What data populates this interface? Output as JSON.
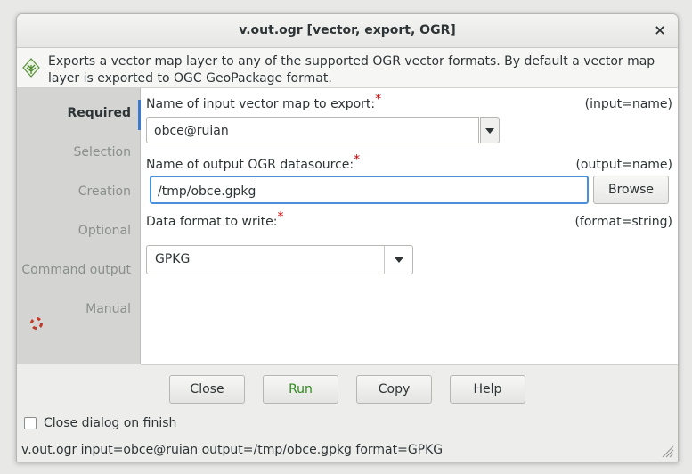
{
  "window": {
    "title": "v.out.ogr [vector, export, OGR]",
    "close_label": "×",
    "description": "Exports a vector map layer to any of the supported OGR vector formats. By default a vector map layer is exported to OGC GeoPackage format."
  },
  "sidebar": {
    "tabs": [
      "Required",
      "Selection",
      "Creation",
      "Optional",
      "Command output",
      "Manual"
    ],
    "active": "Required"
  },
  "form": {
    "input": {
      "label": "Name of input vector map to export:",
      "required_mark": "*",
      "param": "(input=name)",
      "value": "obce@ruian"
    },
    "output": {
      "label": "Name of output OGR datasource:",
      "required_mark": "*",
      "param": "(output=name)",
      "value": "/tmp/obce.gpkg",
      "browse_label": "Browse"
    },
    "format": {
      "label": "Data format to write:",
      "required_mark": "*",
      "param": "(format=string)",
      "value": "GPKG"
    }
  },
  "buttons": {
    "close": "Close",
    "run": "Run",
    "copy": "Copy",
    "help": "Help"
  },
  "checkbox": {
    "label": "Close dialog on finish",
    "checked": false
  },
  "statusbar": {
    "command": "v.out.ogr input=obce@ruian output=/tmp/obce.gpkg format=GPKG"
  },
  "colors": {
    "accent": "#4a90d9",
    "run_text": "#2e8a1b",
    "required": "#cc0000"
  },
  "icons": [
    "grass-logo-icon",
    "close-icon",
    "chevron-down-icon",
    "help-ring-icon",
    "resize-grip-icon"
  ]
}
